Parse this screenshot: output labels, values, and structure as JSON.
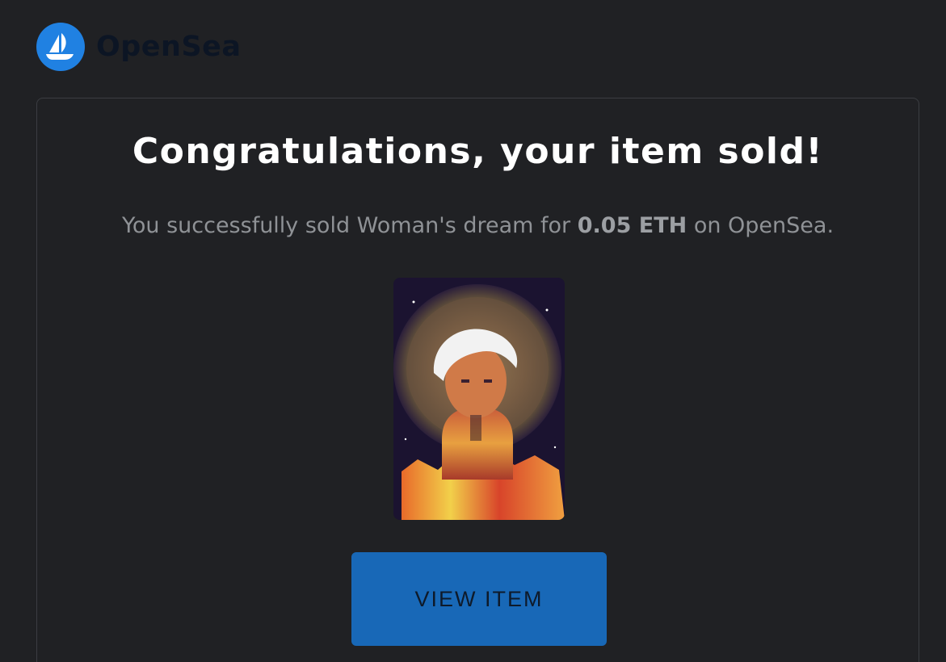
{
  "brand": {
    "name": "OpenSea",
    "logo_icon": "opensea-ship-icon",
    "accent_color": "#2081e2"
  },
  "email": {
    "title": "Congratulations, your item sold!",
    "message_prefix": "You successfully sold Woman's dream for ",
    "price": "0.05 ETH",
    "message_suffix": " on OpenSea.",
    "item_image": "woman-dream-artwork-image",
    "cta_label": "VIEW ITEM",
    "cta_color": "#1868b7"
  }
}
